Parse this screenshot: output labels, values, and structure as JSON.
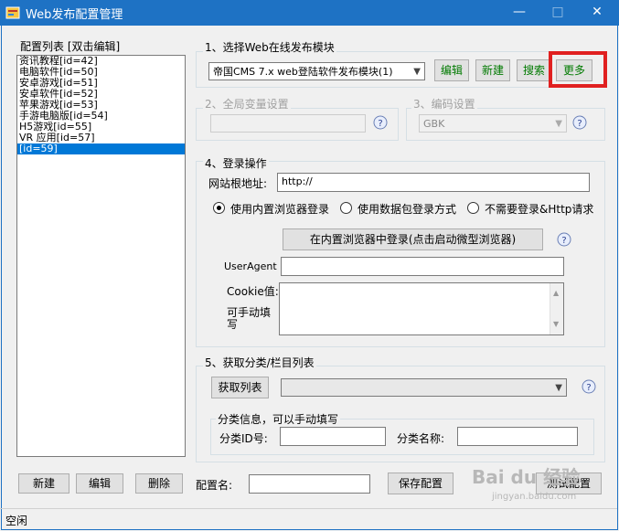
{
  "window": {
    "title": "Web发布配置管理",
    "minimize": "—",
    "maximize": "□",
    "close": "✕"
  },
  "list_panel": {
    "header": "配置列表 [双击编辑]",
    "items": [
      "资讯教程[id=42]",
      "电脑软件[id=50]",
      "安卓游戏[id=51]",
      "安卓软件[id=52]",
      "苹果游戏[id=53]",
      "手游电脑版[id=54]",
      "H5游戏[id=55]",
      "VR 应用[id=57]",
      "[id=59]"
    ],
    "selected_index": 8
  },
  "section1": {
    "label": "1、选择Web在线发布模块",
    "module_select": "帝国CMS 7.x web登陆软件发布模块(1)",
    "edit_btn": "编辑",
    "new_btn": "新建",
    "search_btn": "搜索",
    "more_btn": "更多"
  },
  "section2": {
    "label": "2、全局变量设置"
  },
  "section3": {
    "label": "3、编码设置",
    "encoding": "GBK"
  },
  "section4": {
    "label": "4、登录操作",
    "root_label": "网站根地址:",
    "root_value": "http://",
    "radio1": "使用内置浏览器登录",
    "radio2": "使用数据包登录方式",
    "radio3": "不需要登录&Http请求",
    "browser_login_btn": "在内置浏览器中登录(点击启动微型浏览器)",
    "useragent_label": "UserAgent",
    "cookie_label": "Cookie值:",
    "cookie_hint": "可手动填写"
  },
  "section5": {
    "label": "5、获取分类/栏目列表",
    "fetch_btn": "获取列表",
    "subgroup_label": "分类信息，可以手动填写",
    "cat_id_label": "分类ID号:",
    "cat_name_label": "分类名称:"
  },
  "bottom": {
    "new_btn": "新建",
    "edit_btn": "编辑",
    "delete_btn": "删除",
    "config_name_label": "配置名:",
    "save_btn": "保存配置",
    "test_btn": "测试配置"
  },
  "status": "空闲",
  "watermark": {
    "line1": "Bai du 经验",
    "line2": "jingyan.baidu.com"
  },
  "colors": {
    "titlebar": "#1e72c4",
    "selection": "#0078d7",
    "highlight_box": "#e02020",
    "green_text": "#007a00"
  }
}
